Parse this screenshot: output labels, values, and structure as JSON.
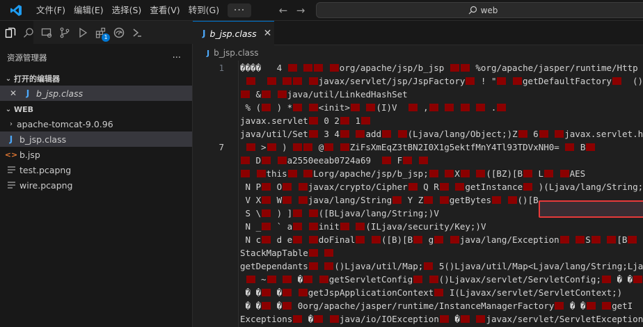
{
  "menu": {
    "items": [
      "文件(F)",
      "编辑(E)",
      "选择(S)",
      "查看(V)",
      "转到(G)"
    ],
    "more": "···"
  },
  "nav": {
    "back": "←",
    "forward": "→"
  },
  "search": {
    "text": "web"
  },
  "activity_badge": "1",
  "sidebar": {
    "title": "资源管理器",
    "more": "···",
    "open_editors": {
      "label": "打开的编辑器",
      "items": [
        {
          "close": "✕",
          "name": "b_jsp.class"
        }
      ]
    },
    "web": {
      "label": "WEB",
      "items": [
        {
          "name": "apache-tomcat-9.0.96",
          "kind": "folder"
        },
        {
          "name": "b_jsp.class",
          "kind": "class",
          "active": true
        },
        {
          "name": "b.jsp",
          "kind": "jsp"
        },
        {
          "name": "test.pcapng",
          "kind": "file"
        },
        {
          "name": "wire.pcapng",
          "kind": "file"
        }
      ]
    }
  },
  "tab": {
    "name": "b_jsp.class",
    "close": "✕"
  },
  "breadcrumb": "b_jsp.class",
  "editor": {
    "current_line": 7,
    "lines": [
      {
        "n": "1",
        "text": "����   4 \u0000 \u0000\u0000 \u0000org/apache/jsp/b_jsp \u0000\u0000 %org/apache/jasper/runtime/Http"
      },
      {
        "n": "",
        "text": " \u0000  \u0000 \u0000\u0000 \u0000javax/servlet/jsp/JspFactory\u0000 ! \"\u0000 \u0000getDefaultFactory\u0000  ()Ljava"
      },
      {
        "n": "",
        "text": "\u0000 &\u0000 \u0000java/util/LinkedHashSet"
      },
      {
        "n": "",
        "text": " % (\u0000 ) *\u0000 \u0000<init>\u0000 \u0000(I)V  \u0000 ,\u0000 \u0000 \u0000 \u0000 .\u0000"
      },
      {
        "n": "",
        "text": "javax.servlet\u0000 0 2\u0000 1\u0000"
      },
      {
        "n": "",
        "text": "java/util/Set\u0000 3 4\u0000 \u0000add\u0000 \u0000(Ljava/lang/Object;)Z\u0000 6\u0000 \u0000javax.servlet.http"
      },
      {
        "n": "7",
        "text": " \u0000 >\u0000 ) \u0000\u0000 @\u0000 \u0000ZiFsXmEqZ3tBN2I0X1g5ektfMnY4Tl93TDVxNH0= \u0000 B\u0000"
      },
      {
        "n": "",
        "text": "\u0000 D\u0000 \u0000a2550eeab0724a69  \u0000 F\u0000 \u0000"
      },
      {
        "n": "",
        "text": "\u0000 \u0000this\u0000 \u0000Lorg/apache/jsp/b_jsp;\u0000 \u0000X\u0000 \u0000([BZ)[B\u0000 L\u0000 \u0000AES"
      },
      {
        "n": "",
        "text": " N P\u0000 O\u0000 \u0000javax/crypto/Cipher\u0000 Q R\u0000 \u0000getInstance\u0000 )(Ljava/lang/String;)Lj"
      },
      {
        "n": "",
        "text": " V X\u0000 W\u0000 \u0000java/lang/String\u0000 Y Z\u0000 \u0000getBytes\u0000 \u0000()[B"
      },
      {
        "n": "",
        "text": " S \\\u0000 ) ]\u0000 \u0000([BLjava/lang/String;)V"
      },
      {
        "n": "",
        "text": " N _\u0000 ` a\u0000 \u0000init\u0000 \u0000(ILjava/security/Key;)V"
      },
      {
        "n": "",
        "text": " N c\u0000 d e\u0000 \u0000doFinal\u0000 \u0000([B)[B\u0000 g\u0000 \u0000java/lang/Exception\u0000 \u0000S\u0000 \u0000[B\u0000 \u0000"
      },
      {
        "n": "",
        "text": "StackMapTable\u0000 \u0000"
      },
      {
        "n": "",
        "text": "getDependants\u0000 \u0000()Ljava/util/Map;\u0000 5()Ljava/util/Map<Ljava/lang/String;Ljava/"
      },
      {
        "n": "",
        "text": " \u0000 ~\u0000 \u0000 �\u0000 \u0000getServletConfig\u0000 \u0000()Ljavax/servlet/ServletConfig;\u0000 � �\u0000"
      },
      {
        "n": "",
        "text": " � �\u0000 �\u0000 \u0000getJspApplicationContext\u0000 I(Ljavax/servlet/ServletContext;)"
      },
      {
        "n": "",
        "text": " � �\u0000 �\u0000 0org/apache/jasper/runtime/InstanceManagerFactory\u0000 � �\u0000 \u0000getI"
      },
      {
        "n": "",
        "text": "Exceptions\u0000 �\u0000 \u0000java/io/IOException\u0000 �\u0000 \u0000javax/servlet/ServletException"
      }
    ]
  },
  "colors": {
    "accent": "#0078d4",
    "highlight_border": "#e83a3a",
    "control_char": "#8b0000"
  }
}
